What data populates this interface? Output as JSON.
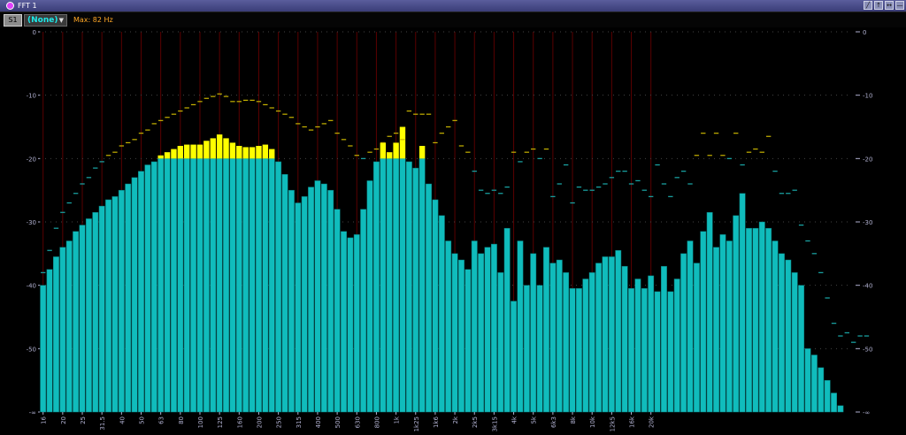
{
  "window": {
    "title": "FFT 1"
  },
  "toolbar": {
    "channel_button": "S1",
    "source_value": "(None)",
    "max_readout": "Max: 82 Hz"
  },
  "colors": {
    "bar": "#10bcbc",
    "bar_edge": "#0a7a7a",
    "overshoot": "#ffff00",
    "peak_hold": "#c8b400",
    "gridline": "#5a0000",
    "axis_text": "#b0b0d0"
  },
  "chart_data": {
    "type": "bar",
    "title": "",
    "xlabel": "",
    "ylabel": "",
    "ylim": [
      -60,
      0
    ],
    "y_ticks": [
      "0",
      "-10",
      "-20",
      "-30",
      "-40",
      "-50",
      "-∞"
    ],
    "x_tick_labels": [
      "16",
      "20",
      "25",
      "31.5",
      "40",
      "50",
      "63",
      "80",
      "100",
      "125",
      "160",
      "200",
      "250",
      "315",
      "400",
      "500",
      "630",
      "800",
      "1k",
      "1k25",
      "1k6",
      "2k",
      "2k5",
      "3k15",
      "4k",
      "5k",
      "6k3",
      "8k",
      "10k",
      "12k5",
      "16k",
      "20k"
    ],
    "categories": [
      "16",
      "",
      "",
      "20",
      "",
      "",
      "25",
      "",
      "",
      "31.5",
      "",
      "",
      "40",
      "",
      "",
      "50",
      "",
      "",
      "63",
      "",
      "",
      "80",
      "",
      "",
      "100",
      "",
      "",
      "125",
      "",
      "",
      "160",
      "",
      "",
      "200",
      "",
      "",
      "250",
      "",
      "",
      "315",
      "",
      "",
      "400",
      "",
      "",
      "500",
      "",
      "",
      "630",
      "",
      "",
      "800",
      "",
      "",
      "1k",
      "",
      "",
      "1k25",
      "",
      "",
      "1k6",
      "",
      "",
      "2k",
      "",
      "",
      "2k5",
      "",
      "",
      "3k15",
      "",
      "",
      "4k",
      "",
      "",
      "5k",
      "",
      "",
      "6k3",
      "",
      "",
      "8k",
      "",
      "",
      "10k",
      "",
      "",
      "12k5",
      "",
      "",
      "16k",
      "",
      "",
      "20k"
    ],
    "clip_level": -20,
    "series": [
      {
        "values": [
          -40,
          -37.5,
          -35.5,
          -34,
          -33,
          -31.5,
          -30.5,
          -29.5,
          -28.5,
          -27.5,
          -26.5,
          -26,
          -25,
          -24,
          -23,
          -22,
          -21,
          -20.5,
          -19.5,
          -19,
          -18.5,
          -18,
          -17.8,
          -17.8,
          -17.8,
          -17.2,
          -16.8,
          -16.2,
          -16.8,
          -17.5,
          -18,
          -18.2,
          -18.2,
          -18,
          -17.8,
          -18.5,
          -20.5,
          -22.5,
          -25,
          -27,
          -26,
          -24.5,
          -23.5,
          -24,
          -25,
          -28,
          -31.5,
          -32.5,
          -32,
          -28,
          -23.5,
          -20.5,
          -17.5,
          -19,
          -17.5,
          -15,
          -20.5,
          -21.5,
          -18,
          -24,
          -26.5,
          -29,
          -33,
          -35,
          -36,
          -37.5,
          -33,
          -35,
          -34,
          -33.5,
          -38,
          -31,
          -42.5,
          -33,
          -40,
          -35,
          -40,
          -34,
          -36.5,
          -36,
          -38,
          -40.5,
          -40.5,
          -39,
          -38,
          -36.5,
          -35.5,
          -35.5,
          -34.5,
          -37,
          -40.5,
          -39,
          -40.5,
          -38.5,
          -41,
          -37,
          -41,
          -39,
          -35,
          -33,
          -36.5,
          -31.5,
          -28.5,
          -34,
          -32,
          -33,
          -29,
          -25.5,
          -31,
          -31,
          -30,
          -31,
          -33,
          -35,
          -36,
          -38,
          -40,
          -50,
          -51,
          -53,
          -55,
          -57,
          -59,
          -60
        ]
      }
    ],
    "peak_hold": [
      -38,
      -34.5,
      -31,
      -28.5,
      -27,
      -25.5,
      -24,
      -23,
      -21.5,
      -20.5,
      -19.5,
      -19,
      -18,
      -17.5,
      -17,
      -16,
      -15.5,
      -14.5,
      -14,
      -13.5,
      -13,
      -12.5,
      -12,
      -11.5,
      -11,
      -10.5,
      -10.2,
      -9.8,
      -10.2,
      -11,
      -11,
      -10.8,
      -10.8,
      -11,
      -11.5,
      -12,
      -12.5,
      -13,
      -13.5,
      -14.5,
      -15,
      -15.5,
      -15,
      -14.5,
      -14,
      -16,
      -17,
      -18,
      -19.5,
      -20,
      -19,
      -18.5,
      -17.5,
      -16.5,
      -16,
      -17,
      -12.5,
      -13,
      -13,
      -13,
      -17.5,
      -16,
      -15,
      -14,
      -18,
      -19,
      -22,
      -25,
      -25.5,
      -25,
      -25.5,
      -24.5,
      -19,
      -20.5,
      -19,
      -18.5,
      -20,
      -18.5,
      -26,
      -24,
      -21,
      -27,
      -24.5,
      -25,
      -25,
      -24.5,
      -24,
      -23,
      -22,
      -22,
      -24,
      -23.5,
      -25,
      -26,
      -21,
      -24,
      -26,
      -23,
      -22,
      -24,
      -19.5,
      -16,
      -19.5,
      -16,
      -19.5,
      -20,
      -16,
      -21,
      -19,
      -18.5,
      -19,
      -16.5,
      -22,
      -25.5,
      -25.5,
      -25,
      -30.5,
      -33,
      -35,
      -38,
      -42,
      -46,
      -48,
      -47.5,
      -49,
      -48,
      -48
    ]
  }
}
